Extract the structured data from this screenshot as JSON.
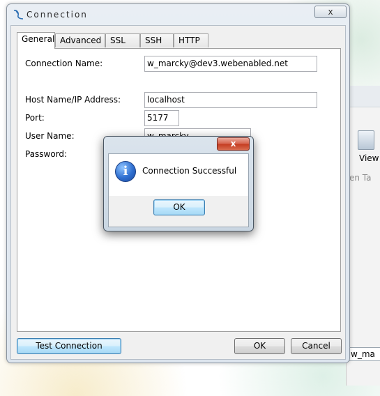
{
  "background_window": {
    "view_label": "View",
    "tab_label": "en Ta",
    "field_fragment": "w_ma"
  },
  "dialog": {
    "title": "Connection",
    "close_label": "x",
    "tabs": [
      {
        "label": "General",
        "active": true
      },
      {
        "label": "Advanced",
        "active": false
      },
      {
        "label": "SSL",
        "active": false
      },
      {
        "label": "SSH",
        "active": false
      },
      {
        "label": "HTTP",
        "active": false
      }
    ],
    "fields": {
      "connection_name": {
        "label": "Connection Name:",
        "value": "w_marcky@dev3.webenabled.net"
      },
      "host": {
        "label": "Host Name/IP Address:",
        "value": "localhost"
      },
      "port": {
        "label": "Port:",
        "value": "5177"
      },
      "user": {
        "label": "User Name:",
        "value": "w_marcky"
      },
      "password": {
        "label": "Password:",
        "value": "••••••••••••"
      }
    },
    "buttons": {
      "test_connection": "Test Connection",
      "ok": "OK",
      "cancel": "Cancel"
    }
  },
  "message_box": {
    "close_label": "x",
    "text": "Connection Successful",
    "icon": "info-icon",
    "ok": "OK"
  }
}
